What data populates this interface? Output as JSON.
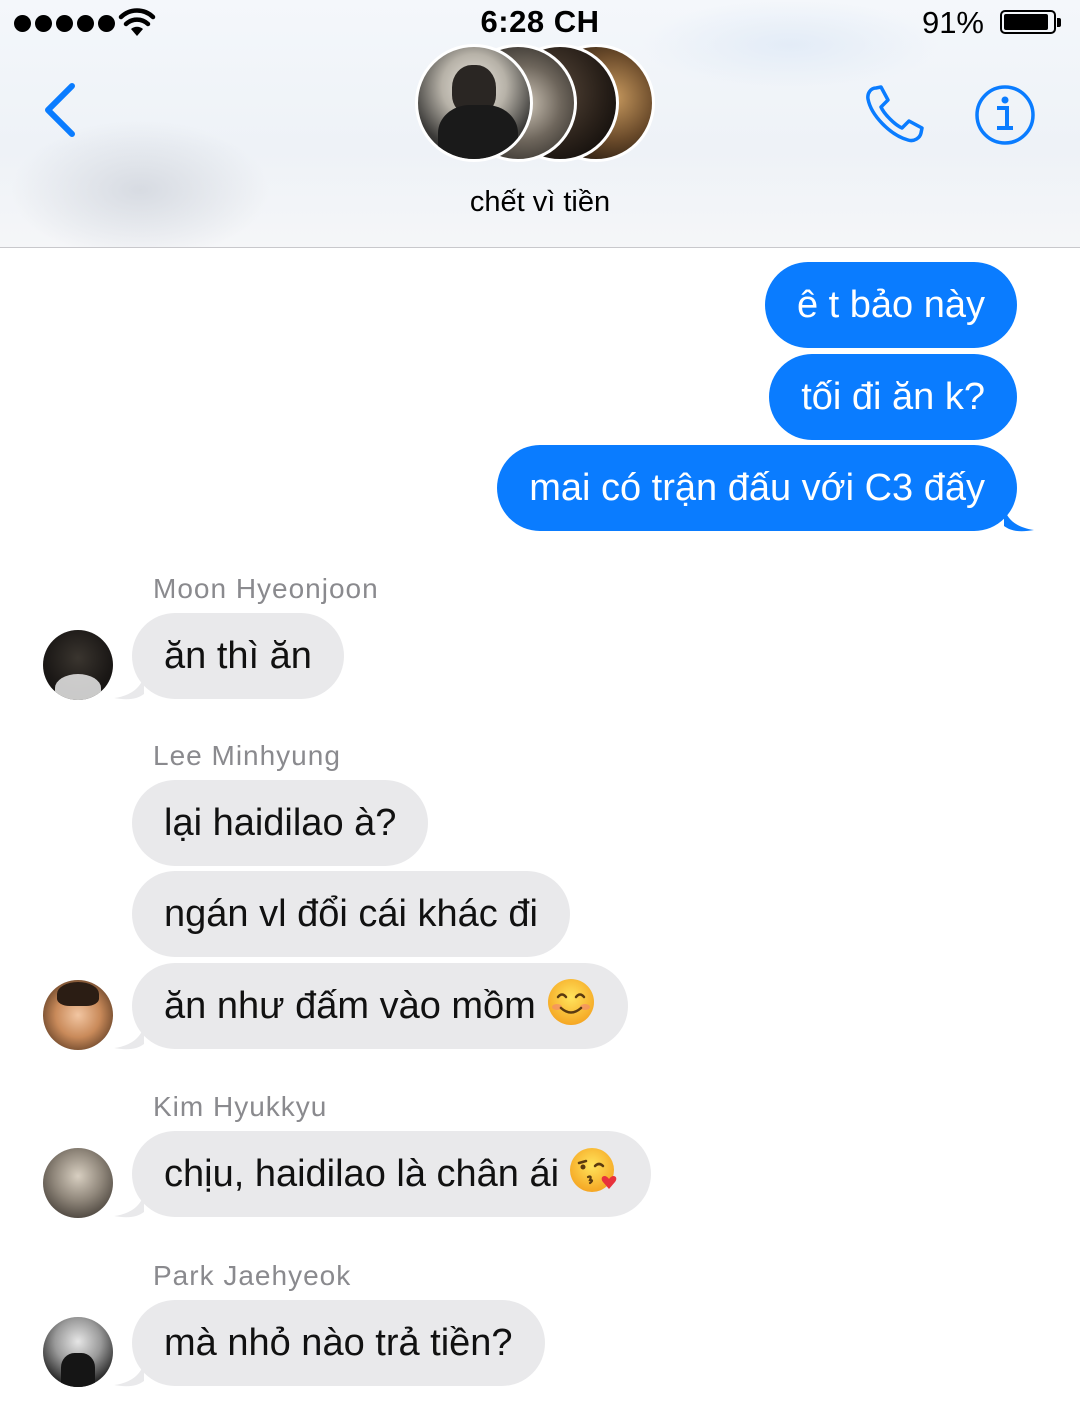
{
  "status_bar": {
    "time": "6:28 CH",
    "battery_percent": "91%",
    "battery_level": 0.91
  },
  "header": {
    "group_name": "chết vì tiền",
    "back_icon": "chevron-left-icon",
    "call_icon": "phone-icon",
    "info_icon": "info-icon",
    "accent_color": "#0a7cff"
  },
  "messages": {
    "outgoing": [
      "ê t bảo này",
      "tối đi ăn k?",
      "mai có trận đấu với C3 đấy"
    ],
    "groups": [
      {
        "sender": "Moon Hyeonjoon",
        "lines": [
          "ăn thì ăn"
        ]
      },
      {
        "sender": "Lee Minhyung",
        "lines": [
          "lại haidilao à?",
          "ngán vl đổi cái khác đi",
          "ăn như đấm vào mồm"
        ]
      },
      {
        "sender": "Kim Hyukkyu",
        "lines": [
          "chịu, haidilao là chân ái"
        ]
      },
      {
        "sender": "Park Jaehyeok",
        "lines": [
          "mà nhỏ nào trả tiền?"
        ]
      }
    ],
    "emoji_icons": [
      "smiling-face-icon",
      "face-blowing-kiss-icon"
    ],
    "outgoing_color": "#0a7cff",
    "incoming_color": "#e9e9eb"
  }
}
